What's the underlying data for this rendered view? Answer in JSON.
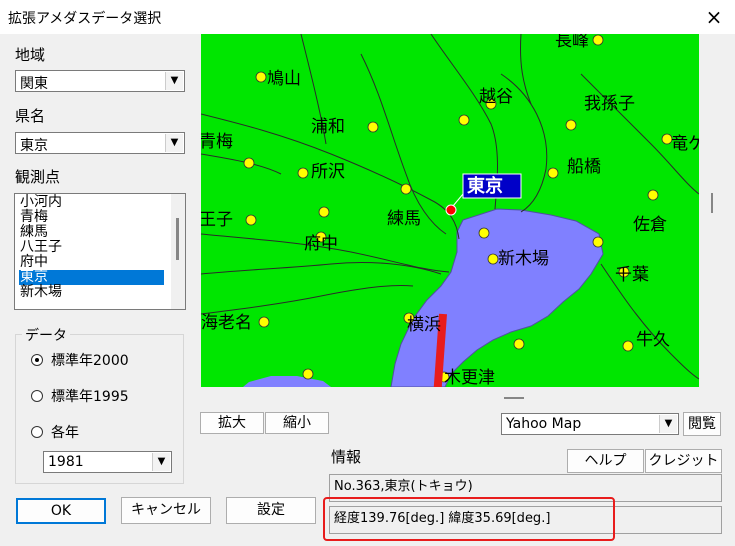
{
  "window": {
    "title": "拡張アメダスデータ選択",
    "close_icon": "×"
  },
  "region": {
    "label": "地域",
    "value": "関東"
  },
  "prefecture": {
    "label": "県名",
    "value": "東京"
  },
  "station": {
    "label": "観測点",
    "items": [
      "小河内",
      "青梅",
      "練馬",
      "八王子",
      "府中",
      "東京",
      "新木場"
    ],
    "selected": "東京"
  },
  "data_group": {
    "label": "データ",
    "options": [
      "標準年2000",
      "標準年1995",
      "各年"
    ],
    "selected": "標準年2000",
    "year_value": "1981"
  },
  "map": {
    "place_labels": [
      "長峰",
      "鳩山",
      "越谷",
      "我孫子",
      "浦和",
      "青梅",
      "竜ケ",
      "所沢",
      "船橋",
      "東京",
      "王子",
      "練馬",
      "佐倉",
      "府中",
      "新木場",
      "千葉",
      "海老名",
      "横浜",
      "牛久",
      "木更津"
    ],
    "colors": {
      "land": "#00e600",
      "water": "#8080ff",
      "dot": "#ffff00",
      "selected_dot": "#ff0000",
      "tag_bg": "#0000c8"
    }
  },
  "buttons": {
    "zoom_in": "拡大",
    "zoom_out": "縮小",
    "view": "閲覧",
    "help": "ヘルプ",
    "credit": "クレジット",
    "ok": "OK",
    "cancel": "キャンセル",
    "settings": "設定"
  },
  "map_source": {
    "value": "Yahoo Map"
  },
  "info": {
    "label": "情報",
    "station_line": "No.363,東京(トキョウ)",
    "coords_line": "経度139.76[deg.] 緯度35.69[deg.]"
  }
}
